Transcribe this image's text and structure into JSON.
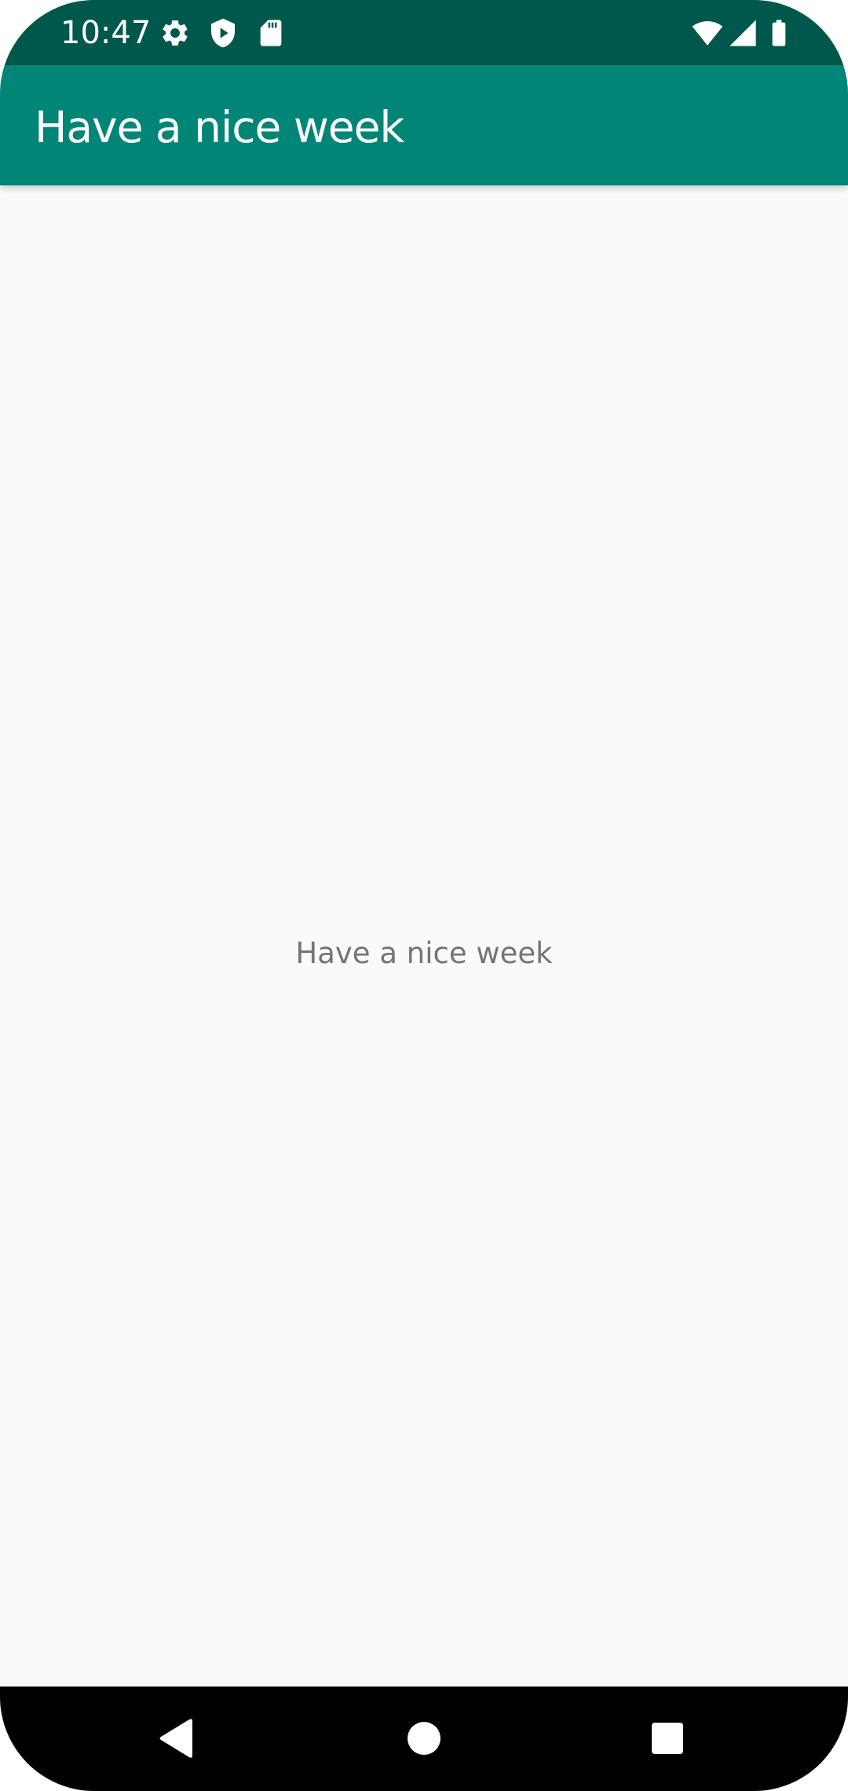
{
  "status_bar": {
    "time": "10:47",
    "icons": [
      "gear-icon",
      "shield-play-icon",
      "sd-card-icon",
      "wifi-icon",
      "signal-icon",
      "battery-icon"
    ]
  },
  "app_bar": {
    "title": "Have a nice week",
    "color": "#008577"
  },
  "content": {
    "message": "Have a nice week"
  },
  "nav_bar": {
    "buttons": [
      "back-icon",
      "home-icon",
      "recents-icon"
    ]
  },
  "colors": {
    "status_bar": "#00574b",
    "app_bar": "#008577",
    "background": "#fafafa",
    "message_text": "#757575"
  }
}
